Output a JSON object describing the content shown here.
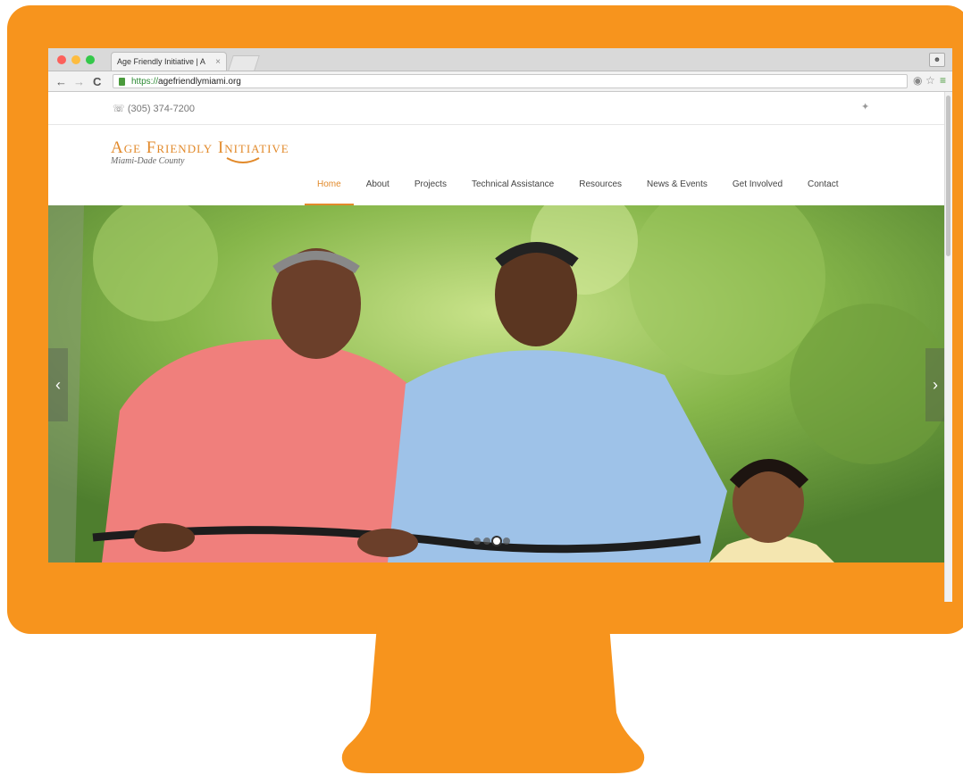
{
  "browser": {
    "tab_title": "Age Friendly Initiative | A",
    "tab_close": "×",
    "url_scheme": "https://",
    "url_host": "agefriendlymiami.org"
  },
  "site": {
    "phone": "(305) 374-7200",
    "logo_title": "Age Friendly Initiative",
    "logo_subtitle": "Miami-Dade County",
    "nav": [
      {
        "label": "Home",
        "active": true
      },
      {
        "label": "About"
      },
      {
        "label": "Projects"
      },
      {
        "label": "Technical Assistance"
      },
      {
        "label": "Resources"
      },
      {
        "label": "News & Events"
      },
      {
        "label": "Get Involved"
      },
      {
        "label": "Contact"
      }
    ],
    "slider": {
      "prev_label": "‹",
      "next_label": "›",
      "slide_count": 4,
      "active_slide": 3
    }
  },
  "colors": {
    "brand_orange": "#f7941d",
    "logo_orange": "#e28a2b"
  },
  "icons": [
    "twitter-icon",
    "phone-icon",
    "lock-icon",
    "back-icon",
    "forward-icon",
    "reload-icon",
    "star-icon",
    "menu-icon",
    "shield-icon"
  ]
}
